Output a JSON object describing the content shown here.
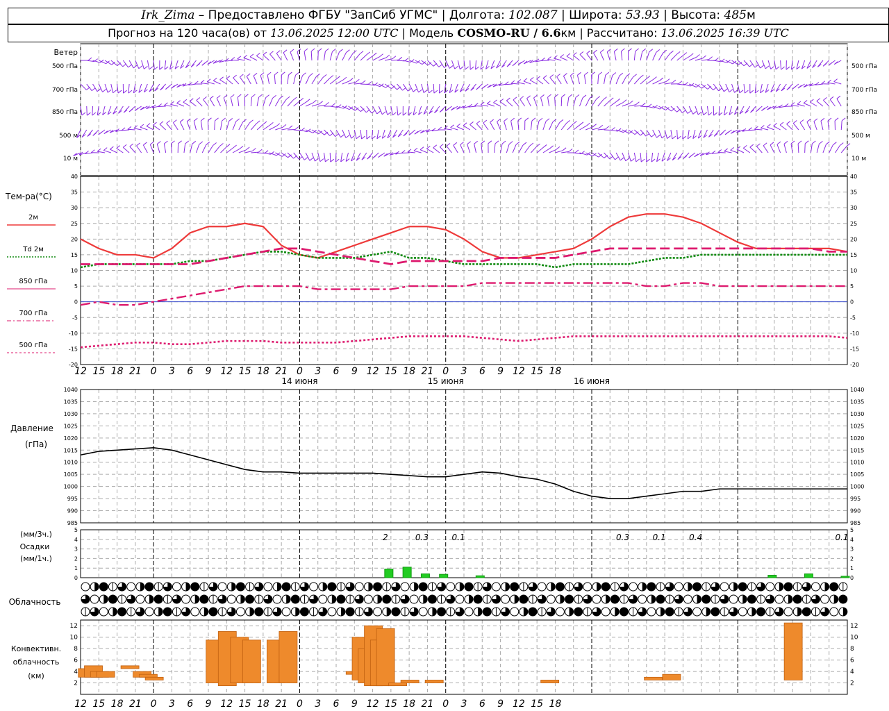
{
  "header": {
    "station": "Irk_Zima",
    "provider": "– Предоставлено ФГБУ \"ЗапСиб УГМС\"",
    "lon_label": "Долгота:",
    "lon": "102.087",
    "lat_label": "Широта:",
    "lat": "53.93",
    "alt_label": "Высота:",
    "alt": "485",
    "alt_unit": "м",
    "forecast_label": "Прогноз на 120 часа(ов) от",
    "forecast_from": "13.06.2025 12:00 UTC",
    "model_label": "Модель",
    "model": "COSMO-RU / 6.6",
    "model_unit": "км",
    "calc_label": "Рассчитано:",
    "calc_time": "13.06.2025 16:39 UTC"
  },
  "colors": {
    "t2m": "#ee3a3a",
    "td2m": "#118a11",
    "t850": "#dd1a6e",
    "t700": "#dd1a6e",
    "t500": "#dd1a6e",
    "wind": "#8a2be2",
    "precip": "#22cc22",
    "convective": "#ee8a2c",
    "pressure": "#000000"
  },
  "time_axis": {
    "hour_labels": [
      "12",
      "15",
      "18",
      "21",
      "0",
      "3",
      "6",
      "9",
      "12",
      "15",
      "18",
      "21",
      "0",
      "3",
      "6",
      "9",
      "12",
      "15",
      "18",
      "21",
      "0",
      "3",
      "6",
      "9",
      "12",
      "15",
      "18"
    ],
    "day_labels": [
      "14 июня",
      "15 июня",
      "16 июня"
    ]
  },
  "wind_panel": {
    "title": "Ветер",
    "levels": [
      "500 гПа",
      "700 гПа",
      "850 гПа",
      "500 м",
      "10  м"
    ]
  },
  "temp_panel": {
    "title": "Тем-ра(°C)",
    "legend": [
      "2м",
      "Td  2м",
      "850 гПа",
      "700 гПа",
      "500 гПа"
    ],
    "y_ticks": [
      40,
      35,
      30,
      25,
      20,
      15,
      10,
      5,
      0,
      -5,
      -10,
      -15,
      -20
    ]
  },
  "pressure_panel": {
    "title": "Давление",
    "unit": "(гПа)",
    "y_ticks": [
      1040,
      1035,
      1030,
      1025,
      1020,
      1015,
      1010,
      1005,
      1000,
      995,
      990,
      985
    ]
  },
  "precip_panel": {
    "label1": "(мм/3ч.)",
    "label2": "Осадки",
    "label3": "(мм/1ч.)",
    "y_ticks": [
      5,
      4,
      3,
      2,
      1,
      0
    ],
    "totals": [
      "2",
      "0.3",
      "0.1",
      "0.3",
      "0.1",
      "0.4",
      "0.1"
    ]
  },
  "cloud_panel": {
    "title": "Облачность"
  },
  "conv_panel": {
    "label1": "Конвективн.",
    "label2": "облачность",
    "label3": "(км)",
    "y_ticks": [
      12,
      10,
      8,
      6,
      4,
      2
    ]
  },
  "chart_data": [
    {
      "type": "line",
      "title": "Тем-ра(°C)",
      "x_hours": [
        0,
        3,
        6,
        9,
        12,
        15,
        18,
        21,
        24,
        27,
        30,
        33,
        36,
        39,
        42,
        45,
        48,
        51,
        54,
        57,
        60,
        63,
        66,
        69,
        72,
        75,
        78,
        81,
        84,
        87,
        90,
        93,
        96,
        99,
        102,
        105,
        108,
        111,
        114,
        117,
        120,
        123,
        126
      ],
      "ylim": [
        -20,
        40
      ],
      "series": [
        {
          "name": "2м",
          "values": [
            20,
            17,
            15,
            15,
            14,
            17,
            22,
            24,
            24,
            25,
            24,
            18,
            15,
            14,
            16,
            18,
            20,
            22,
            24,
            24,
            23,
            20,
            16,
            14,
            14,
            15,
            16,
            17,
            20,
            24,
            27,
            28,
            28,
            27,
            25,
            22,
            19,
            17,
            17,
            17,
            17,
            17,
            16
          ]
        },
        {
          "name": "Td  2м",
          "values": [
            11,
            12,
            12,
            12,
            12,
            12,
            13,
            13,
            14,
            15,
            16,
            16,
            15,
            14,
            14,
            14,
            15,
            16,
            14,
            14,
            13,
            12,
            12,
            12,
            12,
            12,
            11,
            12,
            12,
            12,
            12,
            13,
            14,
            14,
            15,
            15,
            15,
            15,
            15,
            15,
            15,
            15,
            15
          ]
        },
        {
          "name": "850 гПа",
          "values": [
            12,
            12,
            12,
            12,
            12,
            12,
            12,
            13,
            14,
            15,
            16,
            17,
            17,
            16,
            15,
            14,
            13,
            12,
            13,
            13,
            13,
            13,
            13,
            14,
            14,
            14,
            14,
            15,
            16,
            17,
            17,
            17,
            17,
            17,
            17,
            17,
            17,
            17,
            17,
            17,
            17,
            16,
            16
          ]
        },
        {
          "name": "700 гПа",
          "values": [
            -1,
            0,
            -1,
            -1,
            0,
            1,
            2,
            3,
            4,
            5,
            5,
            5,
            5,
            4,
            4,
            4,
            4,
            4,
            5,
            5,
            5,
            5,
            6,
            6,
            6,
            6,
            6,
            6,
            6,
            6,
            6,
            5,
            5,
            6,
            6,
            5,
            5,
            5,
            5,
            5,
            5,
            5,
            5
          ]
        },
        {
          "name": "500 гПа",
          "values": [
            -14.5,
            -14,
            -13.5,
            -13,
            -13,
            -13.5,
            -13.5,
            -13,
            -12.5,
            -12.5,
            -12.5,
            -13,
            -13,
            -13,
            -13,
            -12.5,
            -12,
            -11.5,
            -11,
            -11,
            -11,
            -11,
            -11.5,
            -12,
            -12.5,
            -12,
            -11.5,
            -11,
            -11,
            -11,
            -11,
            -11,
            -11,
            -11,
            -11,
            -11,
            -11,
            -11,
            -11,
            -11,
            -11,
            -11,
            -11.5
          ]
        }
      ]
    },
    {
      "type": "line",
      "title": "Давление",
      "x_hours": [
        0,
        3,
        6,
        9,
        12,
        15,
        18,
        21,
        24,
        27,
        30,
        33,
        36,
        39,
        42,
        45,
        48,
        51,
        54,
        57,
        60,
        63,
        66,
        69,
        72,
        75,
        78,
        81,
        84,
        87,
        90,
        93,
        96,
        99,
        102,
        105,
        108,
        111,
        114,
        117,
        120,
        123,
        126
      ],
      "ylim": [
        985,
        1040
      ],
      "series": [
        {
          "name": "Давление",
          "values": [
            1013,
            1014.5,
            1015,
            1015.5,
            1016,
            1015,
            1013,
            1011,
            1009,
            1007,
            1006,
            1006,
            1005.5,
            1005.5,
            1005.5,
            1005.5,
            1005.5,
            1005,
            1004.5,
            1004,
            1004,
            1005,
            1006,
            1005.5,
            1004,
            1003,
            1001,
            998,
            996,
            995,
            995,
            996,
            997,
            998,
            998,
            999,
            999,
            999,
            999,
            999,
            999,
            999,
            999
          ]
        }
      ]
    },
    {
      "type": "bar",
      "title": "Осадки",
      "x_hours": [
        51,
        54,
        57,
        60,
        66,
        114,
        120,
        126
      ],
      "values": [
        0.9,
        1.1,
        0.4,
        0.35,
        0.2,
        0.25,
        0.4,
        0.15
      ]
    },
    {
      "type": "bar",
      "title": "Конвективн. облачность",
      "segments_km": [
        {
          "h": 1,
          "base": 3,
          "top": 4.5
        },
        {
          "h": 2,
          "base": 3,
          "top": 5
        },
        {
          "h": 3,
          "base": 3,
          "top": 4
        },
        {
          "h": 4,
          "base": 3,
          "top": 4
        },
        {
          "h": 8,
          "base": 4.5,
          "top": 5
        },
        {
          "h": 10,
          "base": 3,
          "top": 4
        },
        {
          "h": 11,
          "base": 3,
          "top": 3.5
        },
        {
          "h": 12,
          "base": 2.5,
          "top": 3
        },
        {
          "h": 22,
          "base": 2,
          "top": 9.5
        },
        {
          "h": 24,
          "base": 1.5,
          "top": 11
        },
        {
          "h": 26,
          "base": 2,
          "top": 10
        },
        {
          "h": 28,
          "base": 2,
          "top": 9.5
        },
        {
          "h": 32,
          "base": 2,
          "top": 9.5
        },
        {
          "h": 34,
          "base": 2,
          "top": 11
        },
        {
          "h": 45,
          "base": 3.5,
          "top": 4
        },
        {
          "h": 46,
          "base": 2.5,
          "top": 10
        },
        {
          "h": 47,
          "base": 2,
          "top": 8
        },
        {
          "h": 48,
          "base": 1.5,
          "top": 12
        },
        {
          "h": 49,
          "base": 1.5,
          "top": 9.5
        },
        {
          "h": 50,
          "base": 1.5,
          "top": 11.5
        },
        {
          "h": 52,
          "base": 1.5,
          "top": 2
        },
        {
          "h": 54,
          "base": 2,
          "top": 2.5
        },
        {
          "h": 58,
          "base": 2,
          "top": 2.5
        },
        {
          "h": 77,
          "base": 2,
          "top": 2.5
        },
        {
          "h": 94,
          "base": 2.5,
          "top": 3
        },
        {
          "h": 97,
          "base": 2.5,
          "top": 3.5
        },
        {
          "h": 117,
          "base": 2.5,
          "top": 12.5
        }
      ]
    }
  ]
}
